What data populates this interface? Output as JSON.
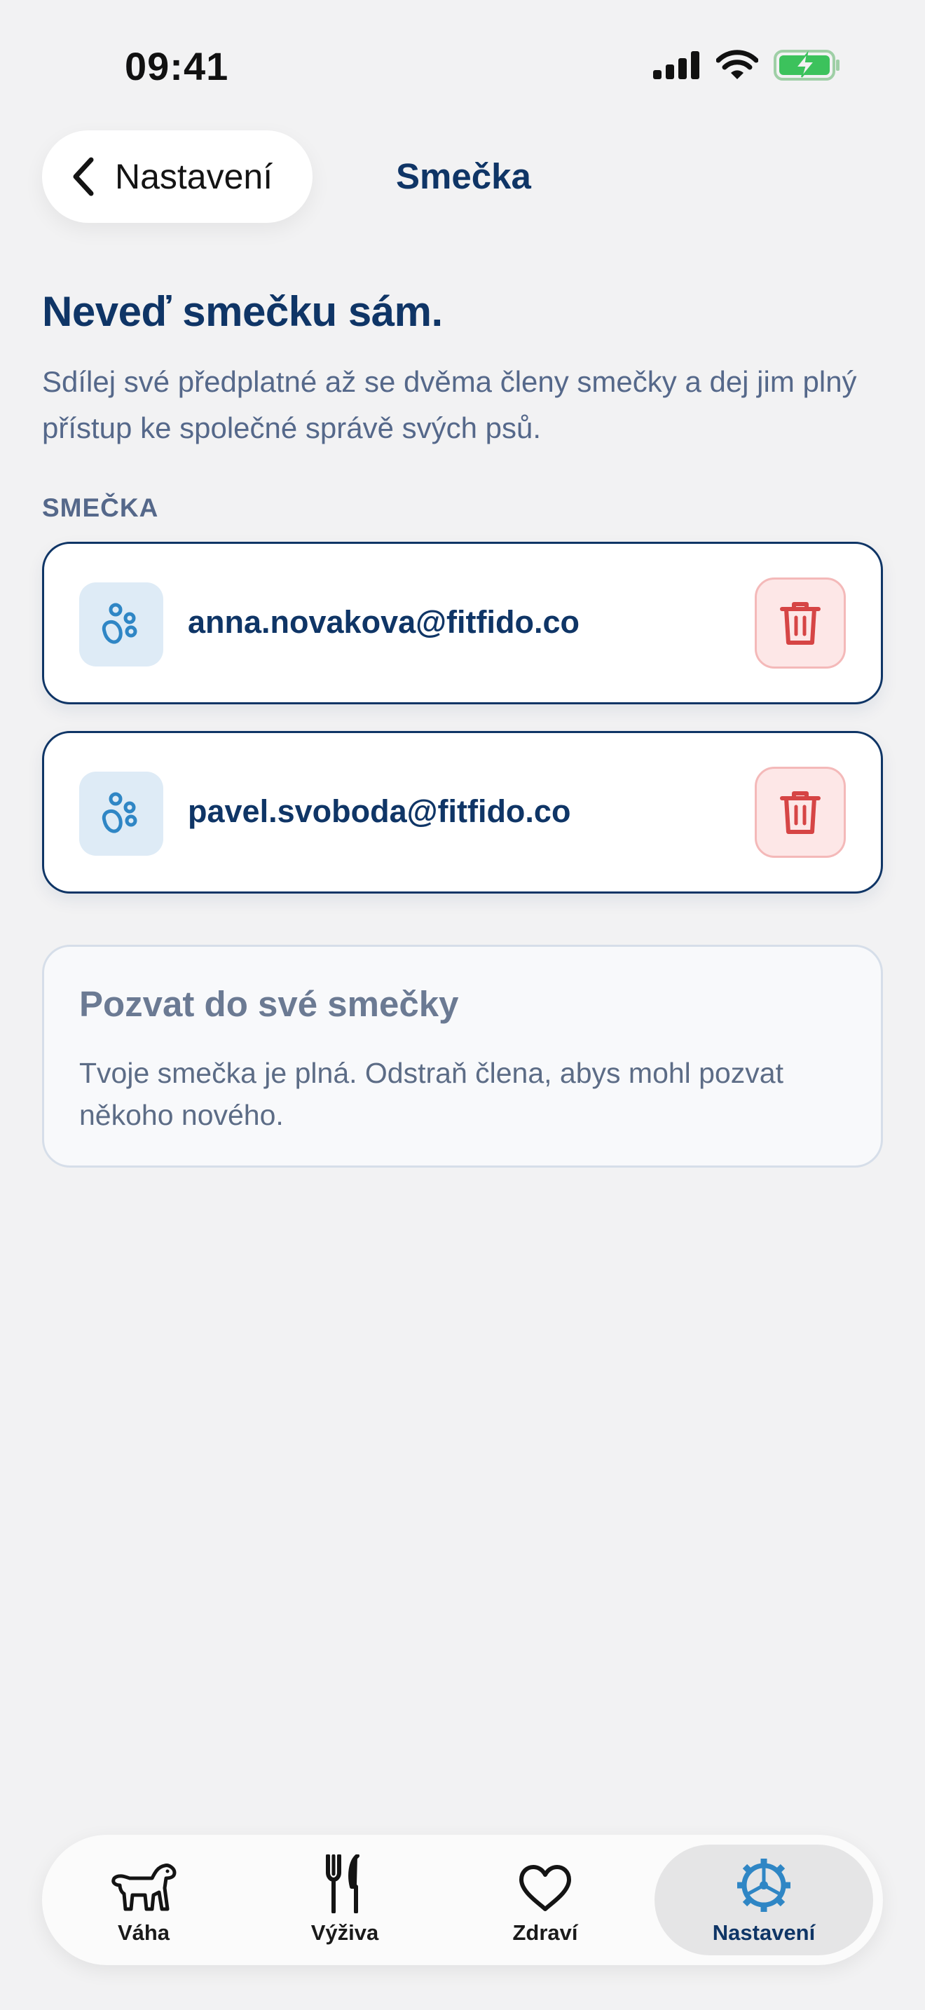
{
  "status_bar": {
    "time": "09:41"
  },
  "header": {
    "back_label": "Nastavení",
    "title": "Smečka"
  },
  "intro": {
    "title": "Neveď smečku sám.",
    "text": "Sdílej své předplatné až se dvěma členy smečky a dej jim plný přístup ke společné správě svých psů."
  },
  "pack": {
    "section_label": "SMEČKA",
    "members": [
      {
        "email": "anna.novakova@fitfido.co"
      },
      {
        "email": "pavel.svoboda@fitfido.co"
      }
    ]
  },
  "invite": {
    "title": "Pozvat do své smečky",
    "text": "Tvoje smečka je plná. Odstraň člena, abys mohl pozvat někoho nového."
  },
  "tab_bar": {
    "tabs": [
      {
        "label": "Váha",
        "icon": "dog-icon"
      },
      {
        "label": "Výživa",
        "icon": "fork-knife-icon"
      },
      {
        "label": "Zdraví",
        "icon": "heart-icon"
      },
      {
        "label": "Nastavení",
        "icon": "gear-icon",
        "active": true
      }
    ]
  },
  "colors": {
    "primary": "#0f3566",
    "accent_blue": "#2f86c5",
    "danger": "#d64545",
    "background": "#f2f2f3"
  }
}
